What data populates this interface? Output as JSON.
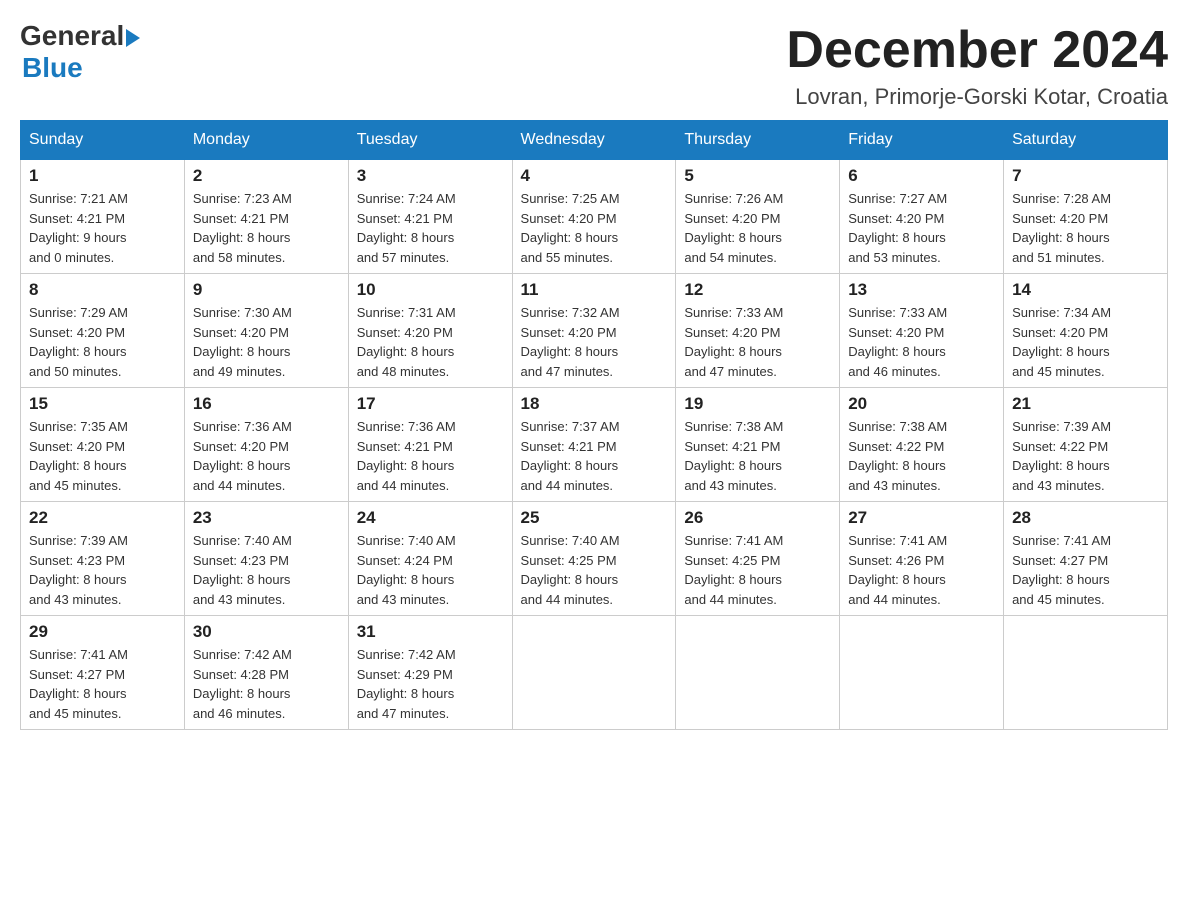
{
  "header": {
    "logo_general": "General",
    "logo_blue": "Blue",
    "month_title": "December 2024",
    "location": "Lovran, Primorje-Gorski Kotar, Croatia"
  },
  "days_of_week": [
    "Sunday",
    "Monday",
    "Tuesday",
    "Wednesday",
    "Thursday",
    "Friday",
    "Saturday"
  ],
  "weeks": [
    [
      {
        "day": "1",
        "sunrise": "7:21 AM",
        "sunset": "4:21 PM",
        "daylight": "9 hours and 0 minutes."
      },
      {
        "day": "2",
        "sunrise": "7:23 AM",
        "sunset": "4:21 PM",
        "daylight": "8 hours and 58 minutes."
      },
      {
        "day": "3",
        "sunrise": "7:24 AM",
        "sunset": "4:21 PM",
        "daylight": "8 hours and 57 minutes."
      },
      {
        "day": "4",
        "sunrise": "7:25 AM",
        "sunset": "4:20 PM",
        "daylight": "8 hours and 55 minutes."
      },
      {
        "day": "5",
        "sunrise": "7:26 AM",
        "sunset": "4:20 PM",
        "daylight": "8 hours and 54 minutes."
      },
      {
        "day": "6",
        "sunrise": "7:27 AM",
        "sunset": "4:20 PM",
        "daylight": "8 hours and 53 minutes."
      },
      {
        "day": "7",
        "sunrise": "7:28 AM",
        "sunset": "4:20 PM",
        "daylight": "8 hours and 51 minutes."
      }
    ],
    [
      {
        "day": "8",
        "sunrise": "7:29 AM",
        "sunset": "4:20 PM",
        "daylight": "8 hours and 50 minutes."
      },
      {
        "day": "9",
        "sunrise": "7:30 AM",
        "sunset": "4:20 PM",
        "daylight": "8 hours and 49 minutes."
      },
      {
        "day": "10",
        "sunrise": "7:31 AM",
        "sunset": "4:20 PM",
        "daylight": "8 hours and 48 minutes."
      },
      {
        "day": "11",
        "sunrise": "7:32 AM",
        "sunset": "4:20 PM",
        "daylight": "8 hours and 47 minutes."
      },
      {
        "day": "12",
        "sunrise": "7:33 AM",
        "sunset": "4:20 PM",
        "daylight": "8 hours and 47 minutes."
      },
      {
        "day": "13",
        "sunrise": "7:33 AM",
        "sunset": "4:20 PM",
        "daylight": "8 hours and 46 minutes."
      },
      {
        "day": "14",
        "sunrise": "7:34 AM",
        "sunset": "4:20 PM",
        "daylight": "8 hours and 45 minutes."
      }
    ],
    [
      {
        "day": "15",
        "sunrise": "7:35 AM",
        "sunset": "4:20 PM",
        "daylight": "8 hours and 45 minutes."
      },
      {
        "day": "16",
        "sunrise": "7:36 AM",
        "sunset": "4:20 PM",
        "daylight": "8 hours and 44 minutes."
      },
      {
        "day": "17",
        "sunrise": "7:36 AM",
        "sunset": "4:21 PM",
        "daylight": "8 hours and 44 minutes."
      },
      {
        "day": "18",
        "sunrise": "7:37 AM",
        "sunset": "4:21 PM",
        "daylight": "8 hours and 44 minutes."
      },
      {
        "day": "19",
        "sunrise": "7:38 AM",
        "sunset": "4:21 PM",
        "daylight": "8 hours and 43 minutes."
      },
      {
        "day": "20",
        "sunrise": "7:38 AM",
        "sunset": "4:22 PM",
        "daylight": "8 hours and 43 minutes."
      },
      {
        "day": "21",
        "sunrise": "7:39 AM",
        "sunset": "4:22 PM",
        "daylight": "8 hours and 43 minutes."
      }
    ],
    [
      {
        "day": "22",
        "sunrise": "7:39 AM",
        "sunset": "4:23 PM",
        "daylight": "8 hours and 43 minutes."
      },
      {
        "day": "23",
        "sunrise": "7:40 AM",
        "sunset": "4:23 PM",
        "daylight": "8 hours and 43 minutes."
      },
      {
        "day": "24",
        "sunrise": "7:40 AM",
        "sunset": "4:24 PM",
        "daylight": "8 hours and 43 minutes."
      },
      {
        "day": "25",
        "sunrise": "7:40 AM",
        "sunset": "4:25 PM",
        "daylight": "8 hours and 44 minutes."
      },
      {
        "day": "26",
        "sunrise": "7:41 AM",
        "sunset": "4:25 PM",
        "daylight": "8 hours and 44 minutes."
      },
      {
        "day": "27",
        "sunrise": "7:41 AM",
        "sunset": "4:26 PM",
        "daylight": "8 hours and 44 minutes."
      },
      {
        "day": "28",
        "sunrise": "7:41 AM",
        "sunset": "4:27 PM",
        "daylight": "8 hours and 45 minutes."
      }
    ],
    [
      {
        "day": "29",
        "sunrise": "7:41 AM",
        "sunset": "4:27 PM",
        "daylight": "8 hours and 45 minutes."
      },
      {
        "day": "30",
        "sunrise": "7:42 AM",
        "sunset": "4:28 PM",
        "daylight": "8 hours and 46 minutes."
      },
      {
        "day": "31",
        "sunrise": "7:42 AM",
        "sunset": "4:29 PM",
        "daylight": "8 hours and 47 minutes."
      },
      null,
      null,
      null,
      null
    ]
  ],
  "labels": {
    "sunrise": "Sunrise:",
    "sunset": "Sunset:",
    "daylight": "Daylight:"
  }
}
